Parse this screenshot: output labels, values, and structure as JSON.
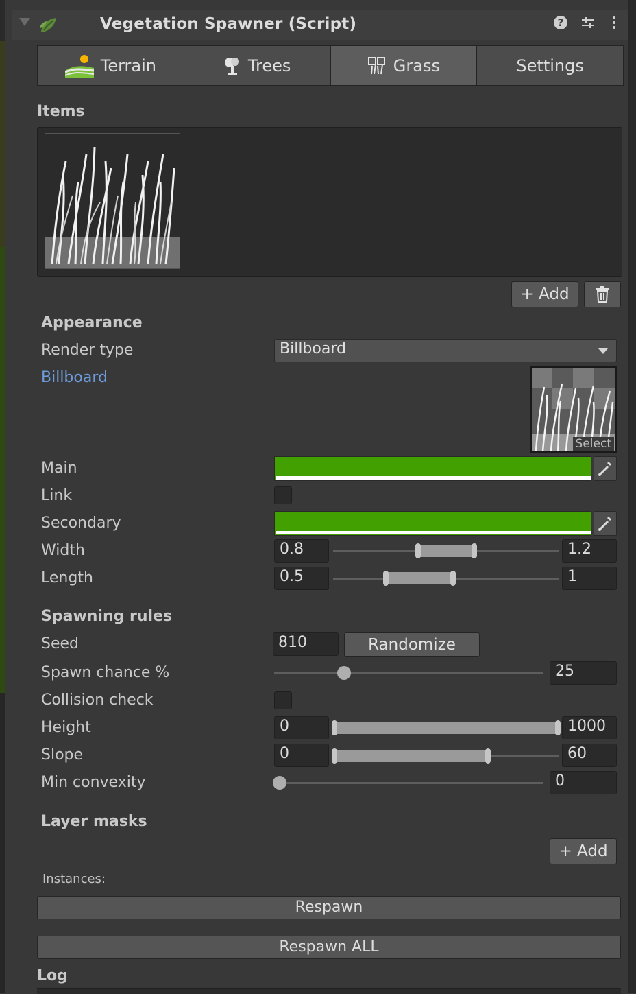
{
  "header": {
    "title": "Vegetation Spawner (Script)",
    "icons": [
      "help-icon",
      "presets-icon",
      "more-icon"
    ]
  },
  "tabs": [
    {
      "label": "Terrain",
      "icon": "terrain-icon",
      "active": false
    },
    {
      "label": "Trees",
      "icon": "tree-icon",
      "active": false
    },
    {
      "label": "Grass",
      "icon": "grass-icon",
      "active": true
    },
    {
      "label": "Settings",
      "icon": null,
      "active": false
    }
  ],
  "items": {
    "heading": "Items",
    "thumbnails": [
      "grass-texture"
    ],
    "add_label": "+ Add",
    "delete_icon": "trash-icon"
  },
  "appearance": {
    "heading": "Appearance",
    "render_type_label": "Render type",
    "render_type_value": "Billboard",
    "billboard_label": "Billboard",
    "billboard_select": "Select",
    "main_label": "Main",
    "main_color": "#42a000",
    "link_label": "Link",
    "link_checked": false,
    "secondary_label": "Secondary",
    "secondary_color": "#42a000",
    "width_label": "Width",
    "width_min": "0.8",
    "width_max": "1.2",
    "length_label": "Length",
    "length_min": "0.5",
    "length_max": "1"
  },
  "spawning": {
    "heading": "Spawning rules",
    "seed_label": "Seed",
    "seed_value": "810",
    "randomize_label": "Randomize",
    "spawn_chance_label": "Spawn chance %",
    "spawn_chance_value": "25",
    "collision_label": "Collision check",
    "collision_checked": false,
    "height_label": "Height",
    "height_min": "0",
    "height_max": "1000",
    "slope_label": "Slope",
    "slope_min": "0",
    "slope_max": "60",
    "convexity_label": "Min convexity",
    "convexity_value": "0"
  },
  "layer_masks": {
    "heading": "Layer masks",
    "add_label": "+ Add"
  },
  "instances": {
    "label": "Instances:",
    "respawn_label": "Respawn",
    "respawn_all_label": "Respawn ALL"
  },
  "log": {
    "heading": "Log"
  }
}
